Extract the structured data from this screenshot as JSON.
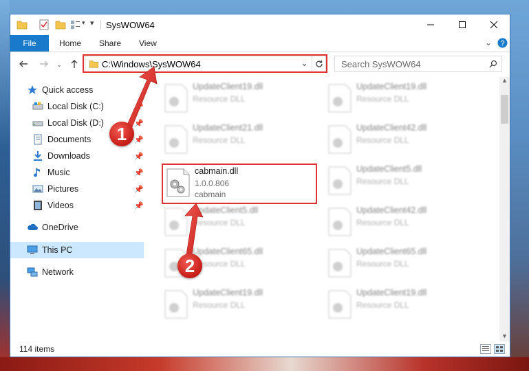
{
  "window": {
    "title": "SysWOW64",
    "controls": {
      "minimize": "minimize",
      "maximize": "maximize",
      "close": "close"
    }
  },
  "ribbon": {
    "file_label": "File",
    "tabs": [
      "Home",
      "Share",
      "View"
    ]
  },
  "address_bar": {
    "path": "C:\\Windows\\SysWOW64"
  },
  "search": {
    "placeholder": "Search SysWOW64"
  },
  "nav_pane": {
    "items": [
      {
        "label": "Quick access",
        "icon": "star-icon",
        "pinned": false
      },
      {
        "label": "Local Disk (C:)",
        "icon": "drive-icon",
        "pinned": true
      },
      {
        "label": "Local Disk (D:)",
        "icon": "drive-icon",
        "pinned": true
      },
      {
        "label": "Documents",
        "icon": "documents-icon",
        "pinned": true
      },
      {
        "label": "Downloads",
        "icon": "download-icon",
        "pinned": true
      },
      {
        "label": "Music",
        "icon": "music-icon",
        "pinned": true
      },
      {
        "label": "Pictures",
        "icon": "pictures-icon",
        "pinned": true
      },
      {
        "label": "Videos",
        "icon": "videos-icon",
        "pinned": true
      },
      {
        "label": "OneDrive",
        "icon": "cloud-icon",
        "pinned": false
      },
      {
        "label": "This PC",
        "icon": "computer-icon",
        "pinned": false,
        "selected": true
      },
      {
        "label": "Network",
        "icon": "network-icon",
        "pinned": false
      }
    ]
  },
  "files": {
    "highlighted": {
      "name": "cabmain.dll",
      "version": "1.0.0.806",
      "description": "cabmain"
    },
    "blurred_items": [
      {
        "name": "UpdateClient19.dll",
        "type": "Resource DLL"
      },
      {
        "name": "UpdateClient19.dll",
        "type": "Resource DLL"
      },
      {
        "name": "UpdateClient21.dll",
        "type": "Resource DLL"
      },
      {
        "name": "UpdateClient42.dll",
        "type": "Resource DLL"
      },
      {
        "name": "UpdateClient5.dll",
        "type": "Resource DLL"
      },
      {
        "name": "UpdateClient5.dll",
        "type": "Resource DLL"
      },
      {
        "name": "UpdateClient42.dll",
        "type": "Resource DLL"
      },
      {
        "name": "UpdateClient65.dll",
        "type": "Resource DLL"
      },
      {
        "name": "UpdateClient65.dll",
        "type": "Resource DLL"
      },
      {
        "name": "UpdateClient19.dll",
        "type": "Resource DLL"
      },
      {
        "name": "UpdateClient19.dll",
        "type": "Resource DLL"
      }
    ]
  },
  "status": {
    "item_count": "114 items"
  },
  "annotations": {
    "step1": "1",
    "step2": "2"
  },
  "colors": {
    "accent": "#1979ca",
    "highlight": "#e03232",
    "selection": "#cce8ff"
  }
}
